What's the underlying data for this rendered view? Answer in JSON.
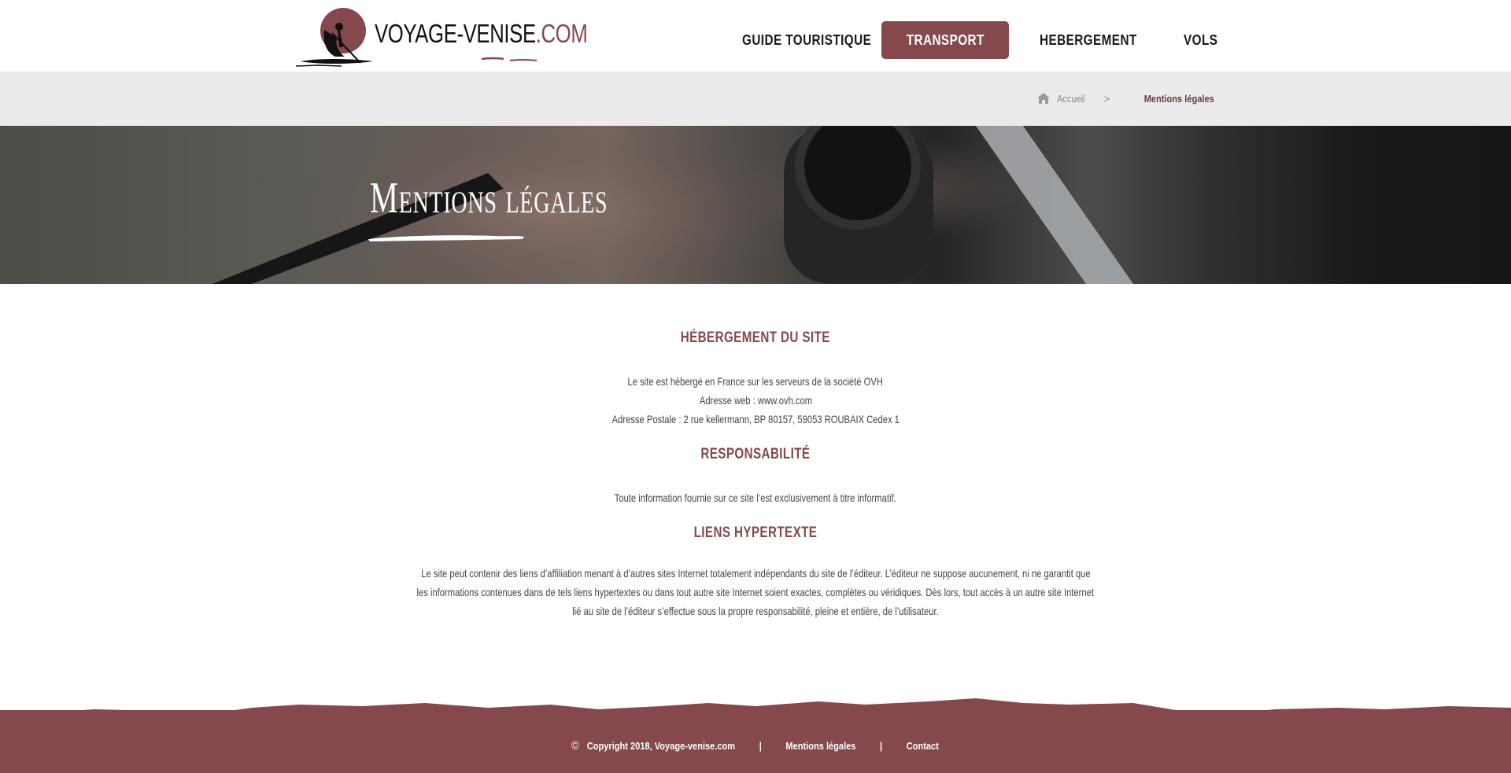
{
  "brand": {
    "name": "VOYAGE-VENISE",
    "domain": ".COM",
    "accent_color": "#85484c"
  },
  "nav": {
    "items": [
      {
        "label": "GUIDE TOURISTIQUE",
        "active": false
      },
      {
        "label": "TRANSPORT",
        "active": true
      },
      {
        "label": "HEBERGEMENT",
        "active": false
      },
      {
        "label": "VOLS",
        "active": false
      }
    ]
  },
  "breadcrumb": {
    "home_icon": "home-icon",
    "home": "Accueil",
    "separator": ">",
    "current": "Mentions légales"
  },
  "hero": {
    "title": "Mentions légales"
  },
  "sections": {
    "hosting": {
      "title": "HÉBERGEMENT DU SITE",
      "lines": [
        "Le site est hébergé en France sur les serveurs de la société OVH",
        "Adresse web : www.ovh.com",
        "Adresse Postale : 2 rue kellermann, BP 80157, 59053 ROUBAIX Cedex 1"
      ]
    },
    "responsibility": {
      "title": "RESPONSABILITÉ",
      "text": "Toute information fournie sur ce site l’est exclusivement à titre informatif."
    },
    "links": {
      "title": "LIENS HYPERTEXTE",
      "lines": [
        "Le site peut contenir des liens d’affiliation menant à d’autres sites Internet totalement indépendants du site de l’éditeur. L’éditeur ne suppose aucunement, ni ne garantit que",
        "les informations contenues dans de tels liens hypertextes ou dans tout autre site Internet soient exactes, complètes ou véridiques. Dès lors, tout accès à un autre site Internet",
        "lié au site de l’éditeur s’effectue sous la propre responsabilité, pleine et entière, de l’utilisateur."
      ]
    }
  },
  "footer": {
    "copyright_icon": "©",
    "copyright": "Copyright 2018, Voyage-venise.com",
    "divider": "|",
    "links": [
      "Mentions légales",
      "Contact"
    ]
  }
}
